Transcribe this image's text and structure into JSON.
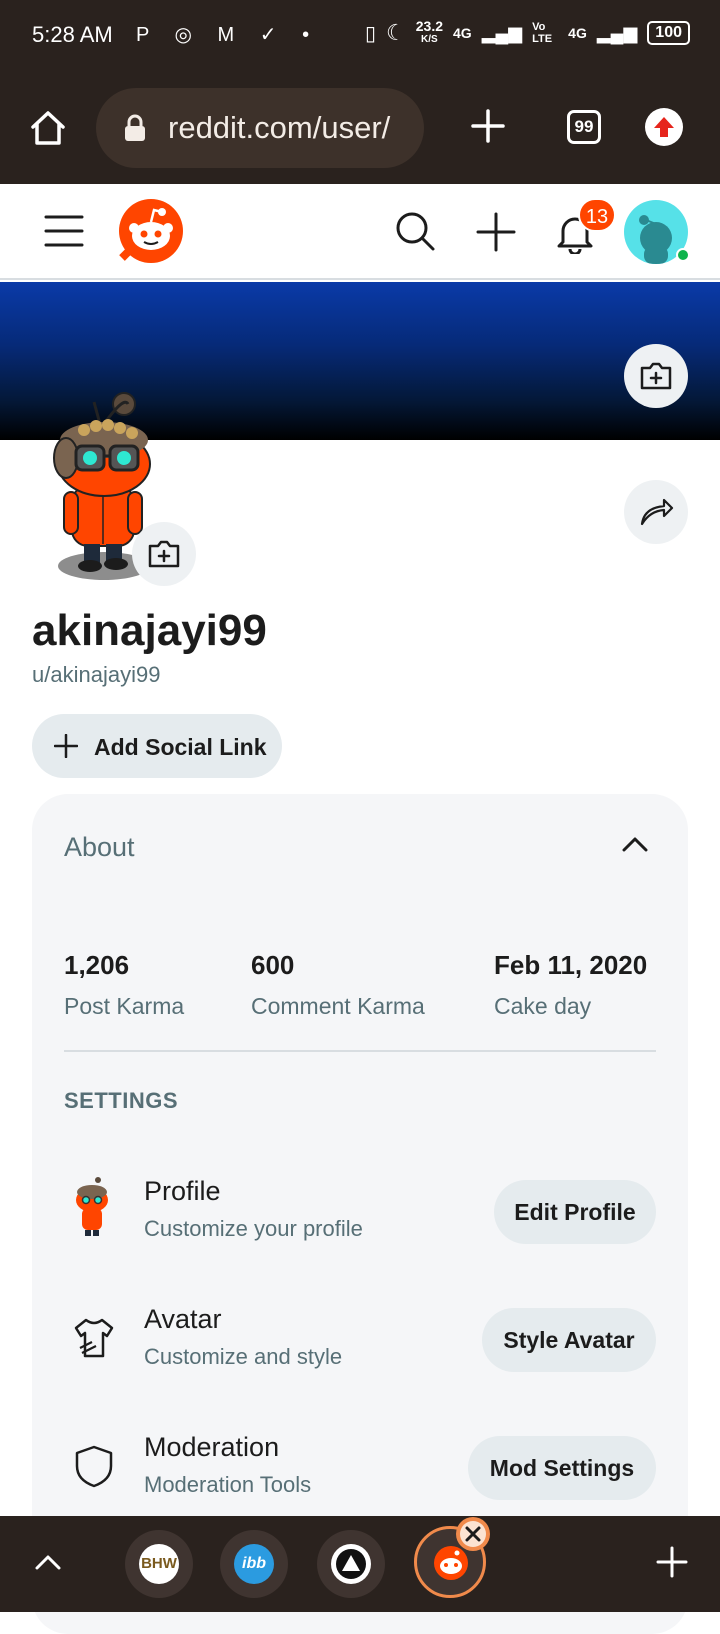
{
  "status_bar": {
    "time": "5:28 AM",
    "notif_icons": "P ◎ M ✓ •",
    "speed_value": "23.2",
    "speed_unit": "K/S",
    "net1": "4G",
    "volte": "Vo LTE",
    "net2": "4G",
    "battery": "100"
  },
  "browser": {
    "url": "reddit.com/user/",
    "tab_count": "99",
    "home_icon": "home-icon",
    "new_tab_icon": "plus-icon",
    "upload_icon": "arrow-up-icon"
  },
  "reddit_header": {
    "notification_count": "13",
    "menu_icon": "hamburger-icon",
    "search_icon": "search-icon",
    "create_icon": "plus-icon",
    "bell_icon": "bell-icon"
  },
  "profile": {
    "display_name": "akinajayi99",
    "handle": "u/akinajayi99",
    "add_social_link": "Add Social Link"
  },
  "about": {
    "title": "About",
    "stats": [
      {
        "value": "1,206",
        "label": "Post Karma"
      },
      {
        "value": "600",
        "label": "Comment Karma"
      },
      {
        "value": "Feb 11, 2020",
        "label": "Cake day"
      }
    ],
    "settings_heading": "SETTINGS",
    "settings": [
      {
        "title": "Profile",
        "subtitle": "Customize your profile",
        "button": "Edit Profile",
        "icon": "avatar-icon"
      },
      {
        "title": "Avatar",
        "subtitle": "Customize and style",
        "button": "Style Avatar",
        "icon": "shirt-icon"
      },
      {
        "title": "Moderation",
        "subtitle": "Moderation Tools",
        "button": "Mod Settings",
        "icon": "shield-icon"
      }
    ]
  },
  "bottom_bar": {
    "apps": [
      {
        "name": "BHW",
        "icon": "bhw-app-icon"
      },
      {
        "name": "ibb",
        "icon": "ibb-app-icon"
      },
      {
        "name": "",
        "icon": "triangle-app-icon"
      },
      {
        "name": "",
        "icon": "reddit-app-icon"
      }
    ]
  },
  "colors": {
    "reddit_orange": "#ff4500",
    "chrome_bg": "#2a221e",
    "card_bg": "#f5f6f8",
    "button_bg": "#e5ebee",
    "muted_text": "#576f76"
  }
}
